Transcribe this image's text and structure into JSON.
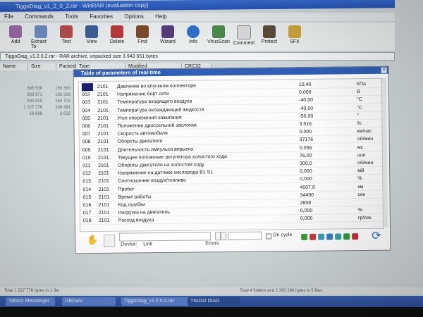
{
  "rar": {
    "title": "TiggoDiag_v1_2_0_2.rar - WinRAR (evaluation copy)",
    "menu": [
      "File",
      "Commands",
      "Tools",
      "Favorites",
      "Options",
      "Help"
    ],
    "toolbar": [
      "Add",
      "Extract To",
      "Test",
      "View",
      "Delete",
      "Find",
      "Wizard",
      "Info",
      "VirusScan",
      "Comment",
      "Protect",
      "SFX"
    ],
    "path": "TiggoDiag_v1.2.0.2.rar - RAR archive, unpacked size 3 943 651 bytes",
    "columns": [
      "Name",
      "Size",
      "Packed",
      "Type",
      "Modified",
      "CRC32"
    ],
    "rows": [
      {
        "size": "385 536",
        "packed": "165 363"
      },
      {
        "size": "383 971",
        "packed": "166 293"
      },
      {
        "size": "390 929",
        "packed": "163 702"
      },
      {
        "size": "1 227 776",
        "packed": "336 491"
      },
      {
        "size": "16 896",
        "packed": "3 633"
      }
    ],
    "status_left": "Total 1 227 776 bytes in 1 file",
    "status_right": "Total 4 folders and 2 390 288 bytes in 5 files"
  },
  "dialog": {
    "title": "Table of parameters of real-time",
    "close": "×",
    "rows": [
      {
        "num": "001",
        "code": "2101",
        "name": "Давление во впускном коллекторе",
        "value": "10,40",
        "unit": "КПа"
      },
      {
        "num": "002",
        "code": "2101",
        "name": "Напряжение борт сети",
        "value": "0,000",
        "unit": "В"
      },
      {
        "num": "003",
        "code": "2101",
        "name": "Температура входящего воздуха",
        "value": "-40,00",
        "unit": "°С"
      },
      {
        "num": "004",
        "code": "2101",
        "name": "Температура охлаждающей жидкости",
        "value": "-40,00",
        "unit": "°С"
      },
      {
        "num": "005",
        "code": "2101",
        "name": "Угол опережения зажигания",
        "value": "-50,00",
        "unit": "°"
      },
      {
        "num": "006",
        "code": "2101",
        "name": "Положение дроссельной заслонки",
        "value": "3,516",
        "unit": "%"
      },
      {
        "num": "007",
        "code": "2101",
        "name": "Скорость автомобиля",
        "value": "0,000",
        "unit": "км/час"
      },
      {
        "num": "008",
        "code": "2101",
        "name": "Обороты двигателя",
        "value": "37176",
        "unit": "об/мин"
      },
      {
        "num": "009",
        "code": "2101",
        "name": "Длительность импульса впрыска",
        "value": "0,056",
        "unit": "мс"
      },
      {
        "num": "010",
        "code": "2101",
        "name": "Текущее положение регулятора холостого хода",
        "value": "76,00",
        "unit": "шаг"
      },
      {
        "num": "011",
        "code": "2101",
        "name": "Обороты двигателя на холостом ходу",
        "value": "300,0",
        "unit": "об/мин"
      },
      {
        "num": "012",
        "code": "2101",
        "name": "Напряжение на датчике кислорода В1 S1",
        "value": "0,000",
        "unit": "мВ"
      },
      {
        "num": "013",
        "code": "2101",
        "name": "Соотношение воздух/топливо",
        "value": "0,000",
        "unit": "%"
      },
      {
        "num": "014",
        "code": "2101",
        "name": "Пробег",
        "value": "4007,8",
        "unit": "км"
      },
      {
        "num": "015",
        "code": "2101",
        "name": "Время работы",
        "value": "34490",
        "unit": "сек"
      },
      {
        "num": "016",
        "code": "2101",
        "name": "Код ошибки",
        "value": "2808",
        "unit": ""
      },
      {
        "num": "017",
        "code": "2101",
        "name": "Нагрузка на двигатель",
        "value": "0,000",
        "unit": "%"
      },
      {
        "num": "018",
        "code": "2101",
        "name": "Расход воздуха",
        "value": "0,000",
        "unit": "гр/сек"
      }
    ],
    "bottom": {
      "device_label": "Device:",
      "link_label": "Link",
      "errors_label": "Errors",
      "on_cycle_label": "On cycle"
    }
  },
  "taskbar": {
    "items": [
      "Yahoo! Messenger",
      "OBDwiz",
      "TiggoDiag_v1.2.0.2.rar",
      "TIGGO DIAG"
    ]
  }
}
